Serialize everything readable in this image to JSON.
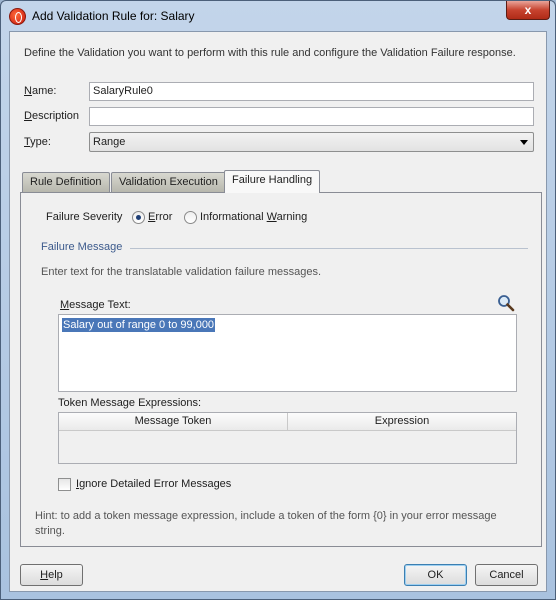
{
  "window": {
    "title": "Add Validation Rule for: Salary",
    "close_glyph": "x"
  },
  "intro": "Define the Validation you want to perform with this rule and configure the Validation Failure response.",
  "fields": {
    "name": {
      "label_mnemonic": "N",
      "label_rest": "ame:",
      "value": "SalaryRule0"
    },
    "description": {
      "label_mnemonic": "D",
      "label_rest": "escription",
      "value": ""
    },
    "type": {
      "label_mnemonic": "T",
      "label_rest": "ype:",
      "value": "Range"
    }
  },
  "tabs": [
    {
      "label": "Rule Definition",
      "active": false
    },
    {
      "label": "Validation Execution",
      "active": false
    },
    {
      "label": "Failure Handling",
      "active": true
    }
  ],
  "failure": {
    "severity_label": "Failure Severity",
    "options": [
      {
        "mnemonic": "E",
        "rest": "rror",
        "checked": true
      },
      {
        "prefix": "Informational ",
        "mnemonic": "W",
        "rest": "arning",
        "checked": false
      }
    ],
    "section_title": "Failure Message",
    "section_hint": "Enter text for the translatable validation failure messages.",
    "message_text_mnemonic": "M",
    "message_text_rest": "essage Text:",
    "message_value": "Salary out of range 0 to 99,000",
    "token_label": "Token Message Expressions:",
    "token_columns": [
      "Message Token",
      "Expression"
    ],
    "ignore_label_mnemonic": "I",
    "ignore_label_rest": "gnore Detailed Error Messages",
    "ignore_checked": false,
    "hint": "Hint: to add a token message expression, include a token of the form {0} in your error message string."
  },
  "buttons": {
    "help_mnemonic": "H",
    "help_rest": "elp",
    "ok": "OK",
    "cancel": "Cancel"
  },
  "icons": {
    "app": "oracle-jdeveloper-icon",
    "search": "magnifier-icon",
    "dropdown": "chevron-down-icon"
  }
}
